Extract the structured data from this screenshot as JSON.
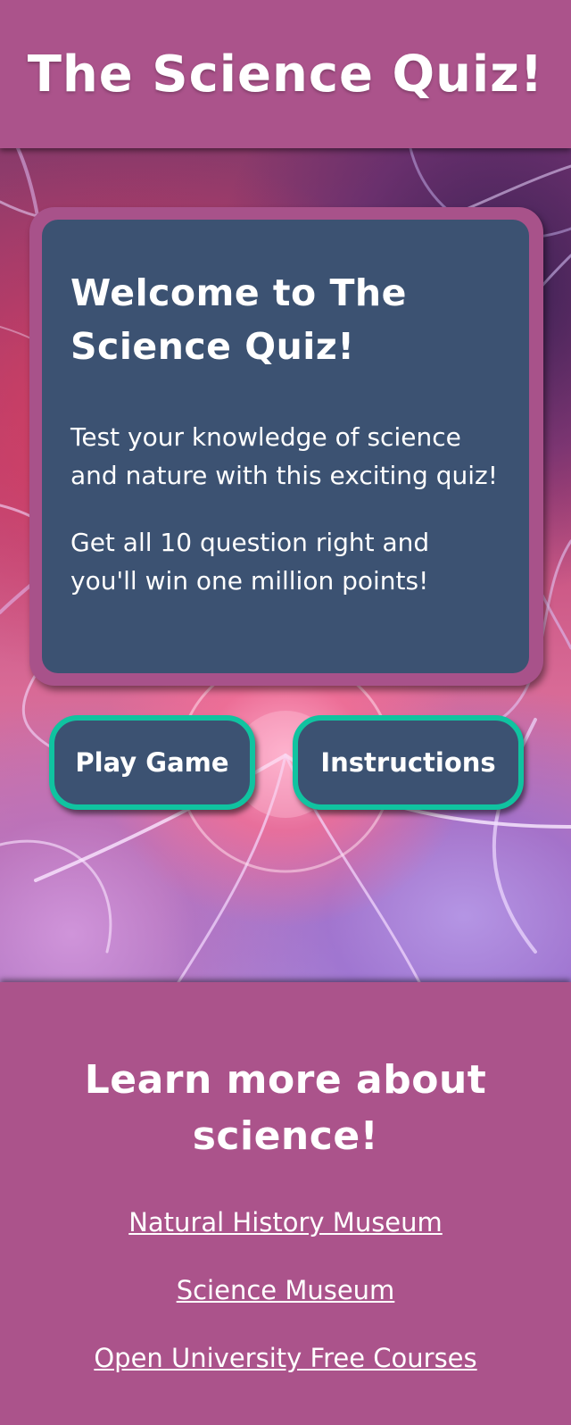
{
  "header": {
    "title": "The Science Quiz!"
  },
  "welcome": {
    "heading": "Welcome to The Science Quiz!",
    "paragraphs": [
      "Test your knowledge of science and nature with this exciting quiz!",
      "Get all 10 question right and you'll win one million points!"
    ]
  },
  "buttons": {
    "play_label": "Play Game",
    "instructions_label": "Instructions"
  },
  "footer": {
    "heading": "Learn more about science!",
    "links": [
      {
        "label": "Natural History Museum"
      },
      {
        "label": "Science Museum"
      },
      {
        "label": "Open University Free Courses"
      }
    ]
  },
  "colors": {
    "brand_pink": "#ab538b",
    "card_navy": "#3c5272",
    "button_border_teal": "#10c3a0",
    "text_white": "#ffffff"
  },
  "background_image": "plasma-ball"
}
